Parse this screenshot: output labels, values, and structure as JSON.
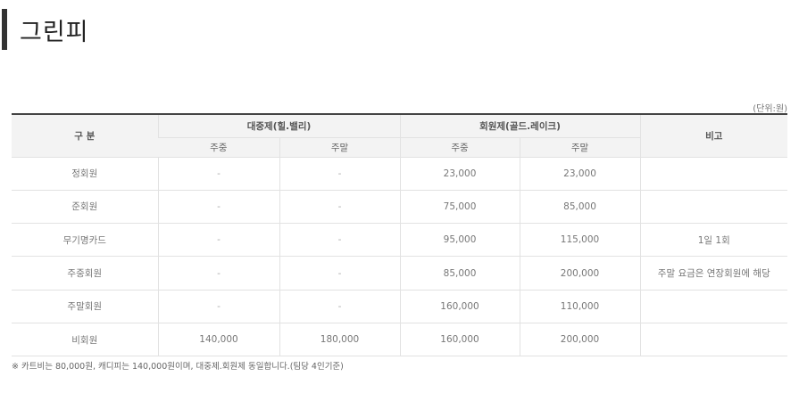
{
  "title": "그린피",
  "unit": "(단위:원)",
  "header": {
    "col_category": "구 분",
    "group_public": "대중제(힐.밸리)",
    "group_member": "회원제(골드.레이크)",
    "col_remarks": "비고",
    "weekday": "주중",
    "weekend": "주말"
  },
  "rows": [
    {
      "name": "정회원",
      "pub_weekday": "-",
      "pub_weekend": "-",
      "mem_weekday": "23,000",
      "mem_weekend": "23,000",
      "remarks": ""
    },
    {
      "name": "준회원",
      "pub_weekday": "-",
      "pub_weekend": "-",
      "mem_weekday": "75,000",
      "mem_weekend": "85,000",
      "remarks": ""
    },
    {
      "name": "무기명카드",
      "pub_weekday": "-",
      "pub_weekend": "-",
      "mem_weekday": "95,000",
      "mem_weekend": "115,000",
      "remarks": "1일 1회"
    },
    {
      "name": "주중회원",
      "pub_weekday": "-",
      "pub_weekend": "-",
      "mem_weekday": "85,000",
      "mem_weekend": "200,000",
      "remarks": "주말 요금은 연장회원에 해당"
    },
    {
      "name": "주말회원",
      "pub_weekday": "-",
      "pub_weekend": "-",
      "mem_weekday": "160,000",
      "mem_weekend": "110,000",
      "remarks": ""
    },
    {
      "name": "비회원",
      "pub_weekday": "140,000",
      "pub_weekend": "180,000",
      "mem_weekday": "160,000",
      "mem_weekend": "200,000",
      "remarks": ""
    }
  ],
  "note": "※ 카트비는 80,000원, 캐디피는 140,000원이며, 대중제.회원제 동일합니다.(팀당 4인기준)"
}
